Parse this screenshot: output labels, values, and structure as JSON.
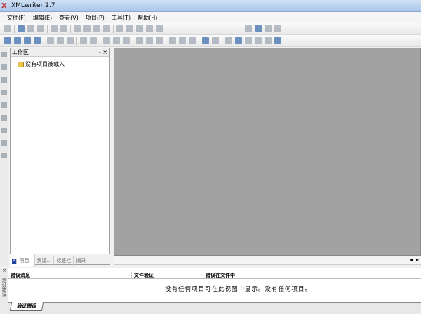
{
  "window": {
    "title": "XMLwriter 2.7",
    "logo": "X"
  },
  "menu": [
    "文件(F)",
    "编辑(E)",
    "查看(V)",
    "项目(P)",
    "工具(T)",
    "帮助(H)"
  ],
  "workspace": {
    "title": "工作区",
    "controls": "- ×",
    "tree_item": "没有项目被载入",
    "tabs": [
      "项目",
      "资源...",
      "标签栏",
      "摘录"
    ]
  },
  "errors": {
    "close": "×",
    "side_label": "验证错误",
    "columns": [
      "错误消息",
      "文件验证",
      "错误在文件中"
    ],
    "message": "没有任何项目可在此视图中显示。没有任何项目。",
    "tab": "验证错误"
  },
  "scroll": {
    "left": "◂",
    "right": "▸"
  }
}
